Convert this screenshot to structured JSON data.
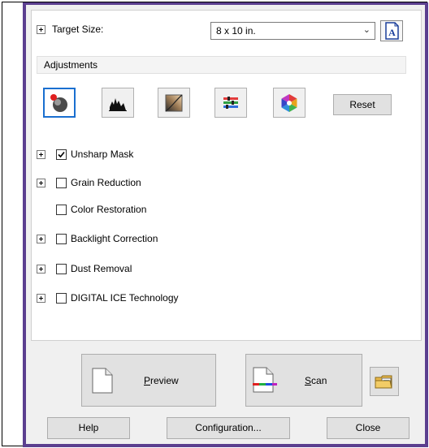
{
  "target_size": {
    "label": "Target Size:",
    "value": "8 x 10 in."
  },
  "adjustments": {
    "header": "Adjustments",
    "reset_label": "Reset"
  },
  "options": [
    {
      "label": "Unsharp Mask",
      "checked": true,
      "expandable": true
    },
    {
      "label": "Grain Reduction",
      "checked": false,
      "expandable": true
    },
    {
      "label": "Color Restoration",
      "checked": false,
      "expandable": false
    },
    {
      "label": "Backlight Correction",
      "checked": false,
      "expandable": true
    },
    {
      "label": "Dust Removal",
      "checked": false,
      "expandable": true
    },
    {
      "label": "DIGITAL ICE Technology",
      "checked": false,
      "expandable": true
    }
  ],
  "preview": {
    "mnemonic": "P",
    "rest": "review"
  },
  "scan": {
    "mnemonic": "S",
    "rest": "can"
  },
  "footer": {
    "help": "Help",
    "configuration": "Configuration...",
    "close": "Close"
  },
  "colors": {
    "frame": "#5b3f8f",
    "active_border": "#1a6fd0"
  }
}
